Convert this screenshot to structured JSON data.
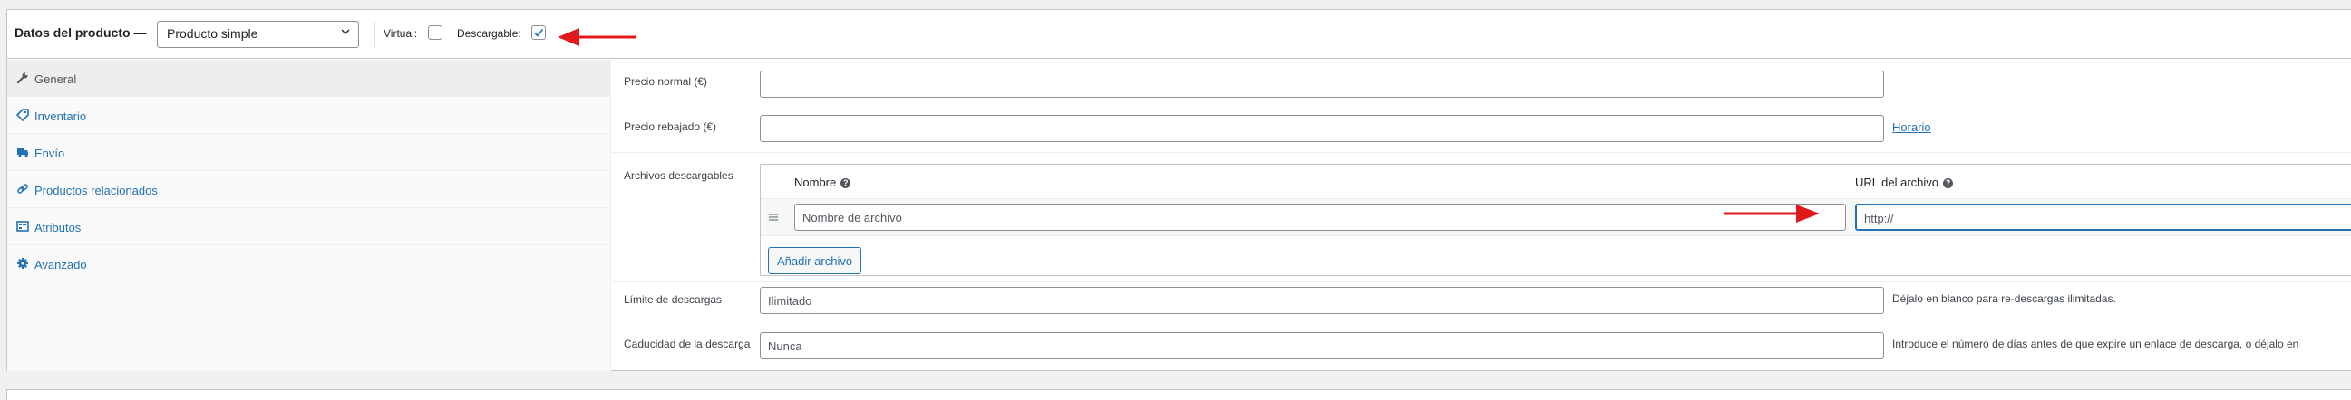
{
  "header": {
    "title": "Datos del producto —",
    "product_type": "Producto simple",
    "virtual_label": "Virtual:",
    "virtual_checked": false,
    "downloadable_label": "Descargable:",
    "downloadable_checked": true
  },
  "sidebar": {
    "items": [
      {
        "label": "General",
        "icon": "wrench-icon",
        "active": true
      },
      {
        "label": "Inventario",
        "icon": "tag-icon",
        "active": false
      },
      {
        "label": "Envío",
        "icon": "truck-icon",
        "active": false
      },
      {
        "label": "Productos relacionados",
        "icon": "link-icon",
        "active": false
      },
      {
        "label": "Atributos",
        "icon": "list-table-icon",
        "active": false
      },
      {
        "label": "Avanzado",
        "icon": "gear-icon",
        "active": false
      }
    ]
  },
  "general": {
    "regular_price_label": "Precio normal (€)",
    "regular_price_value": "",
    "sale_price_label": "Precio rebajado (€)",
    "sale_price_value": "",
    "schedule_link": "Horario",
    "downloadable_files_label": "Archivos descargables",
    "files_table": {
      "col_name": "Nombre",
      "col_url": "URL del archivo",
      "rows": [
        {
          "name_placeholder": "Nombre de archivo",
          "url_value": "http://"
        }
      ],
      "add_button": "Añadir archivo"
    },
    "download_limit_label": "Límite de descargas",
    "download_limit_placeholder": "Ilimitado",
    "download_limit_hint": "Déjalo en blanco para re-descargas ilimitadas.",
    "download_expiry_label": "Caducidad de la descarga",
    "download_expiry_placeholder": "Nunca",
    "download_expiry_hint": "Introduce el número de días antes de que expire un enlace de descarga, o déjalo en"
  },
  "colors": {
    "accent": "#2271b1",
    "annotation_arrow": "#e0191b"
  }
}
